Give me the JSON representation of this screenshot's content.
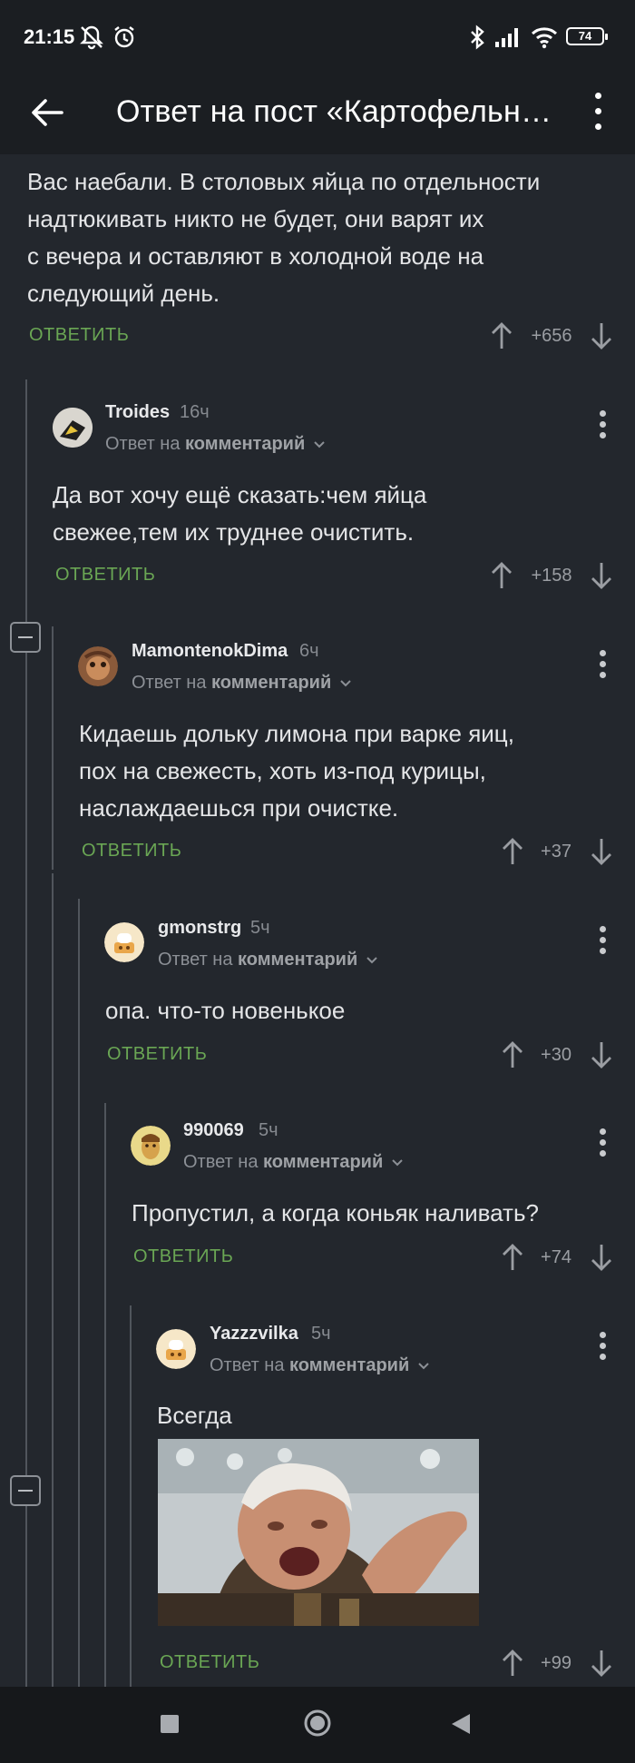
{
  "status_bar": {
    "time": "21:15",
    "battery": "74"
  },
  "app_bar": {
    "title": "Ответ на пост «Картофельные ответы»",
    "back_icon": "arrow-left-icon",
    "menu_icon": "more-vert-icon"
  },
  "comments": [
    {
      "text_lines": [
        "Вас наебали. В столовых яйца по отдельности",
        "надтюкивать никто не будет, они варят их",
        "с вечера и оставляют в холодной воде на",
        "следующий день."
      ],
      "reply_label": "ОТВЕТИТЬ",
      "score": "+656"
    },
    {
      "author": "Troides",
      "ago": "16ч",
      "reply_to_prefix": "Ответ на",
      "reply_to_link": "комментарий",
      "text_lines": [
        "Да вот хочу ещё сказать:чем яйца",
        "свежее,тем их труднее очистить."
      ],
      "reply_label": "ОТВЕТИТЬ",
      "score": "+158"
    },
    {
      "author": "MamontenokDima",
      "ago": "6ч",
      "reply_to_prefix": "Ответ на",
      "reply_to_link": "комментарий",
      "text_lines": [
        "Кидаешь дольку лимона при варке яиц,",
        "пох на свежесть, хоть из-под курицы,",
        "наслаждаешься при очистке."
      ],
      "reply_label": "ОТВЕТИТЬ",
      "score": "+37"
    },
    {
      "author": "gmonstrg",
      "ago": "5ч",
      "reply_to_prefix": "Ответ на",
      "reply_to_link": "комментарий",
      "text_lines": [
        "опа. что-то новенькое"
      ],
      "reply_label": "ОТВЕТИТЬ",
      "score": "+30"
    },
    {
      "author": "990069",
      "ago": "5ч",
      "reply_to_prefix": "Ответ на",
      "reply_to_link": "комментарий",
      "text_lines": [
        "Пропустил, а когда коньяк наливать?"
      ],
      "reply_label": "ОТВЕТИТЬ",
      "score": "+74"
    },
    {
      "author": "Yazzzvilka",
      "ago": "5ч",
      "reply_to_prefix": "Ответ на",
      "reply_to_link": "комментарий",
      "text_lines": [
        "Всегда"
      ],
      "reply_label": "ОТВЕТИТЬ",
      "score": "+99"
    }
  ],
  "colors": {
    "background": "#23272d",
    "reply_green": "#6aa654",
    "bar": "#1b1e22"
  }
}
